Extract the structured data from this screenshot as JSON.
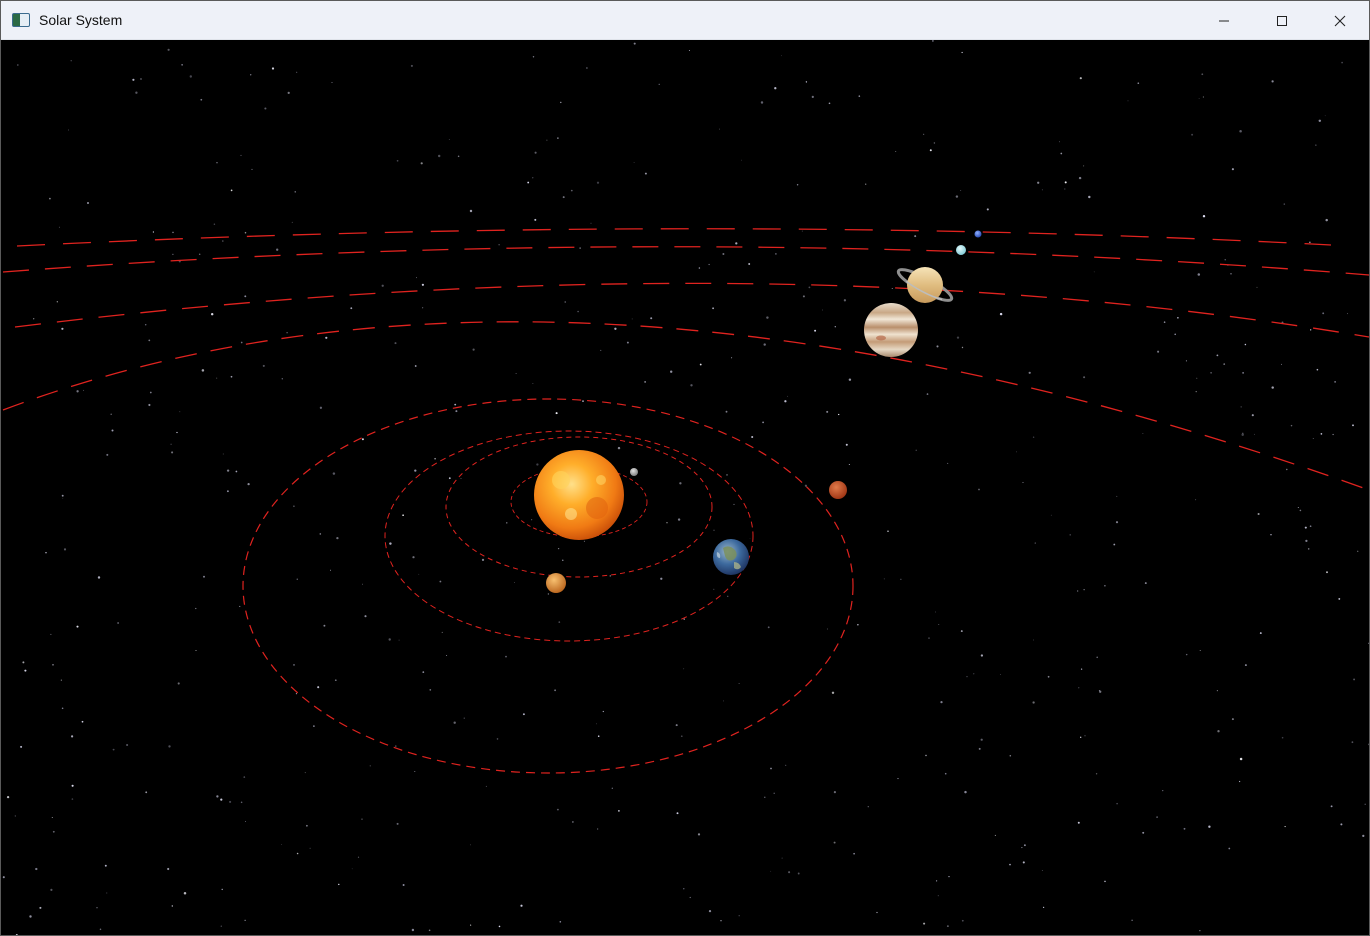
{
  "window": {
    "title": "Solar System",
    "controls": {
      "minimize": "minimize-icon",
      "maximize": "maximize-icon",
      "close": "close-icon"
    }
  },
  "scene": {
    "background": "#000000",
    "orbit_color": "#e0231f",
    "bodies": [
      {
        "name": "sun",
        "color": "#f07a14"
      },
      {
        "name": "mercury",
        "color": "#9a9a9a"
      },
      {
        "name": "venus",
        "color": "#d9821e"
      },
      {
        "name": "earth",
        "color": "#2c5aa0"
      },
      {
        "name": "mars",
        "color": "#c2481f"
      },
      {
        "name": "jupiter",
        "color": "#d8c2a8"
      },
      {
        "name": "saturn",
        "color": "#e3c68e"
      },
      {
        "name": "uranus",
        "color": "#a9e1e8"
      },
      {
        "name": "neptune",
        "color": "#3a64d8"
      }
    ]
  }
}
